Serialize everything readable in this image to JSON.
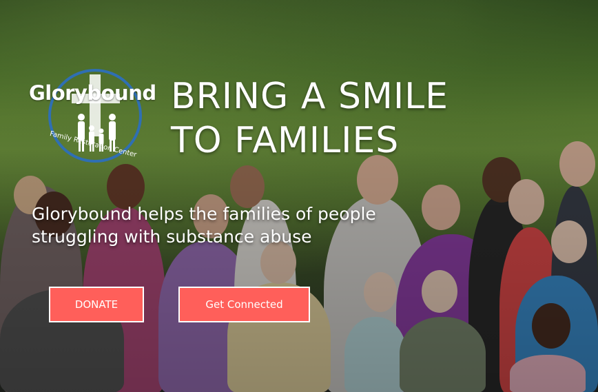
{
  "logo": {
    "title": "Glorybound",
    "subtitle": "Family Restoration Center",
    "ring_color": "#2f6fb3"
  },
  "hero": {
    "headline_line1": "BRING A SMILE",
    "headline_line2": "TO FAMILIES",
    "tagline_line1": "Glorybound helps the families of people",
    "tagline_line2": "struggling with substance abuse"
  },
  "buttons": {
    "donate_label": "DONATE",
    "connect_label": "Get Connected",
    "color": "#ff5f5a"
  }
}
